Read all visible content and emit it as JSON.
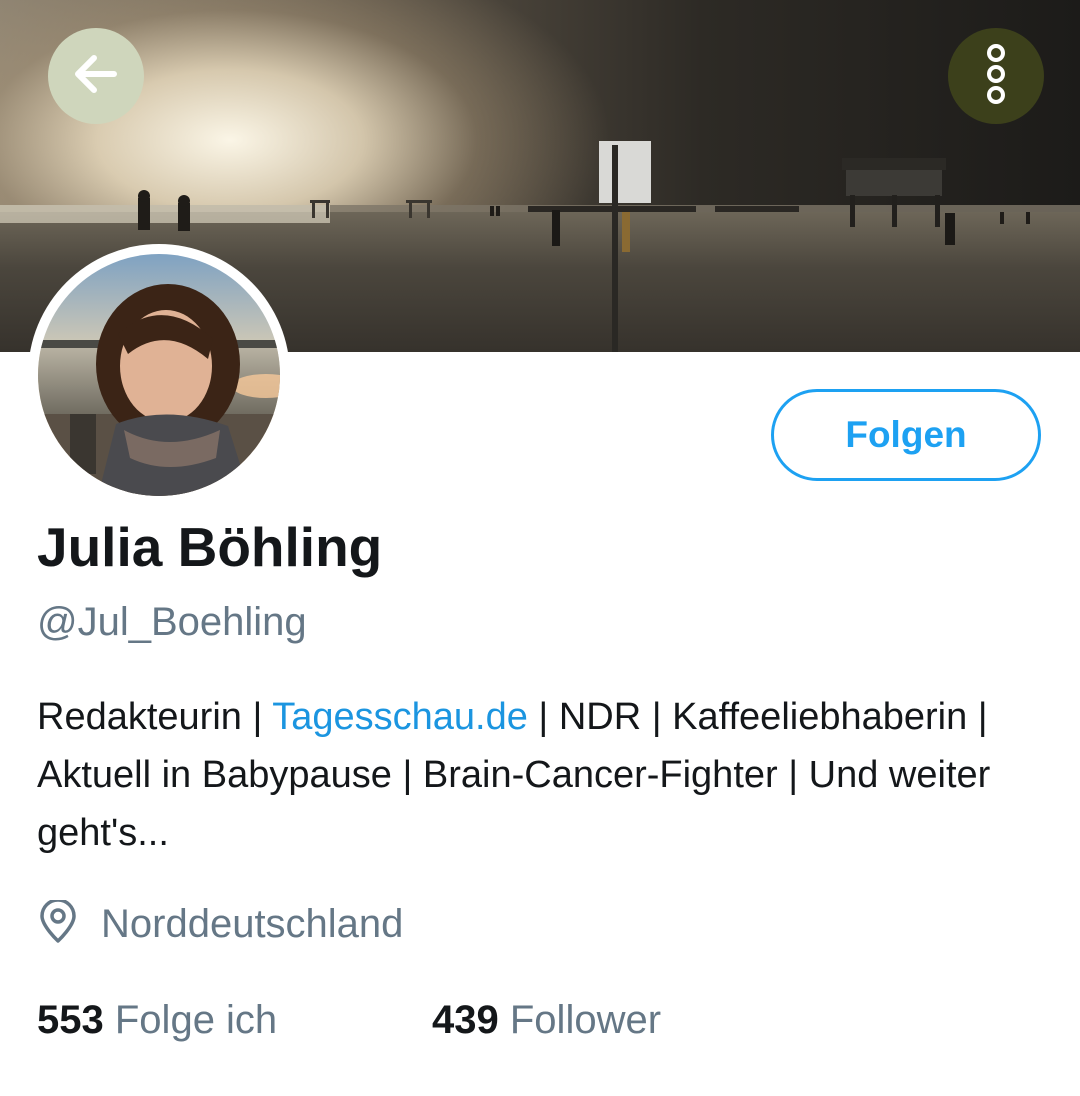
{
  "header": {
    "back_icon": "arrow-left-icon",
    "more_icon": "more-vertical-icon"
  },
  "profile": {
    "name": "Julia Böhling",
    "handle": "@Jul_Boehling",
    "follow_label": "Folgen",
    "bio": {
      "part1": "Redakteurin | ",
      "link": "Tagesschau.de",
      "part2": " | NDR | Kaffeeliebhaberin | Aktuell in Babypause | Brain-Cancer-Fighter | Und weiter geht's..."
    },
    "location_icon": "location-pin-icon",
    "location": "Norddeutschland",
    "following_count": "553",
    "following_label": "Folge ich",
    "followers_count": "439",
    "followers_label": "Follower"
  },
  "colors": {
    "accent": "#1da1f2",
    "link": "#1b95e0",
    "text": "#14171a",
    "secondary": "#657786"
  }
}
